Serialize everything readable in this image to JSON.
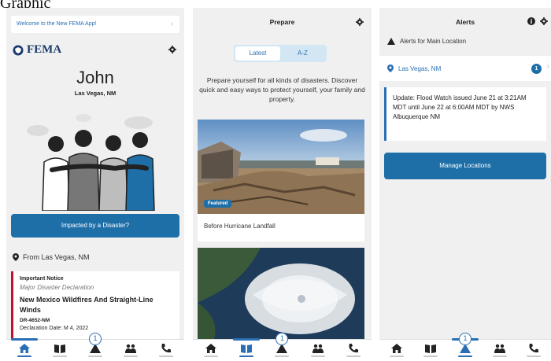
{
  "caption": "Graphic",
  "phone1": {
    "welcome": "Welcome to the New FEMA App!",
    "logo_text": "FEMA",
    "user_name": "John",
    "user_location": "Las Vegas, NM",
    "impacted_button": "Impacted by a Disaster?",
    "from_label": "From Las Vegas, NM",
    "notice": {
      "heading": "Important Notice",
      "type": "Major Disaster Declaration",
      "title": "New Mexico Wildfires And Straight-Line Winds",
      "code": "DR-4652-NM",
      "date": "Declaration Date: M  4, 2022"
    },
    "nav_badge": "1"
  },
  "phone2": {
    "title": "Prepare",
    "tabs": [
      "Latest",
      "A-Z"
    ],
    "intro": "Prepare yourself for all kinds of disasters. Discover quick and easy ways to protect yourself, your family and property.",
    "featured_badge": "Featured",
    "card1_caption": "Before Hurricane Landfall",
    "nav_badge": "1"
  },
  "phone3": {
    "title": "Alerts",
    "alerts_for": "Alerts for Main Location",
    "location": "Las Vegas, NM",
    "location_badge": "1",
    "update": "Update: Flood Watch issued June 21 at 3:21AM MDT until June 22 at 6:00AM MDT by NWS Albuquerque NM",
    "manage_button": "Manage Locations",
    "nav_badge": "1"
  },
  "colors": {
    "primary": "#1e6fa8",
    "alert_red": "#c8102e",
    "background": "#f0f0f0"
  }
}
